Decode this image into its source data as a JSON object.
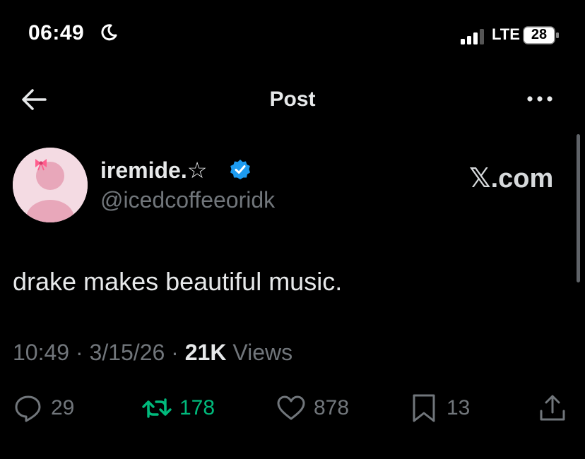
{
  "status_bar": {
    "time": "06:49",
    "network": "LTE",
    "battery": "28"
  },
  "header": {
    "title": "Post"
  },
  "post": {
    "display_name": "iremide.☆",
    "handle": "@icedcoffeeoridk",
    "watermark": "𝕏.com",
    "text": "drake makes beautiful music.",
    "time": "10:49",
    "date": "3/15/26",
    "views_count": "21K",
    "views_label": "Views",
    "separator": "·"
  },
  "actions": {
    "replies": "29",
    "reposts": "178",
    "likes": "878",
    "bookmarks": "13"
  },
  "colors": {
    "background": "#000000",
    "text_primary": "#e7e9ea",
    "text_secondary": "#71767b",
    "repost_active": "#00ba7c",
    "verified": "#1d9bf0",
    "avatar_bg": "#f4dbe3"
  },
  "icons": [
    "moon-icon",
    "signal-icon",
    "battery-icon",
    "back-arrow-icon",
    "more-icon",
    "verified-icon",
    "reply-icon",
    "repost-icon",
    "like-icon",
    "bookmark-icon",
    "share-icon"
  ]
}
